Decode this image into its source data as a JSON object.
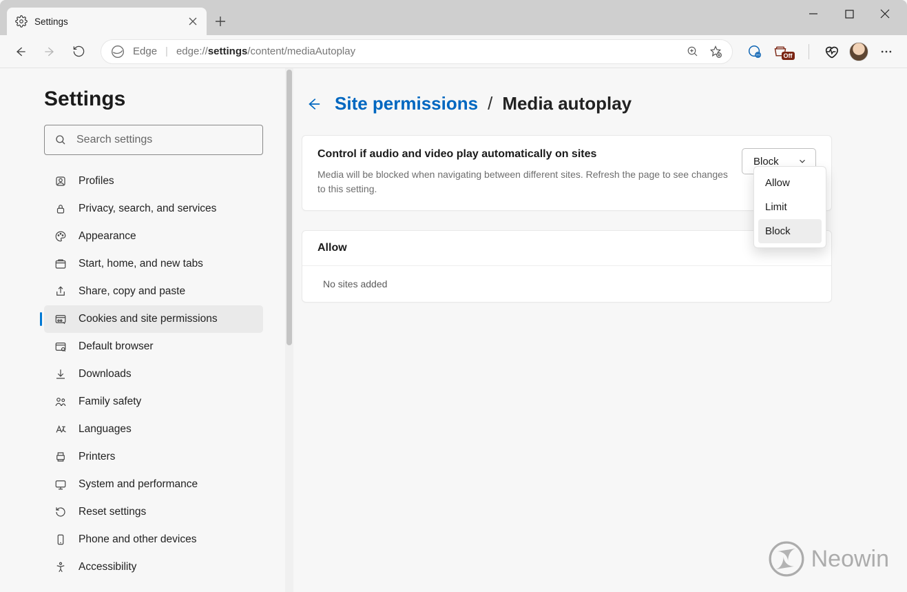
{
  "tab": {
    "title": "Settings"
  },
  "addressbar": {
    "identity": "Edge",
    "url_prefix": "edge://",
    "url_bold": "settings",
    "url_rest": "/content/mediaAutoplay"
  },
  "sidebar": {
    "title": "Settings",
    "search_placeholder": "Search settings",
    "items": [
      {
        "label": "Profiles",
        "icon": "profile-icon"
      },
      {
        "label": "Privacy, search, and services",
        "icon": "lock-icon"
      },
      {
        "label": "Appearance",
        "icon": "palette-icon"
      },
      {
        "label": "Start, home, and new tabs",
        "icon": "tabs-icon"
      },
      {
        "label": "Share, copy and paste",
        "icon": "share-icon"
      },
      {
        "label": "Cookies and site permissions",
        "icon": "cookies-icon",
        "active": true
      },
      {
        "label": "Default browser",
        "icon": "browser-icon"
      },
      {
        "label": "Downloads",
        "icon": "download-icon"
      },
      {
        "label": "Family safety",
        "icon": "family-icon"
      },
      {
        "label": "Languages",
        "icon": "language-icon"
      },
      {
        "label": "Printers",
        "icon": "printer-icon"
      },
      {
        "label": "System and performance",
        "icon": "system-icon"
      },
      {
        "label": "Reset settings",
        "icon": "reset-icon"
      },
      {
        "label": "Phone and other devices",
        "icon": "phone-icon"
      },
      {
        "label": "Accessibility",
        "icon": "accessibility-icon"
      }
    ]
  },
  "main": {
    "breadcrumb_link": "Site permissions",
    "breadcrumb_current": "Media autoplay",
    "setting_title": "Control if audio and video play automatically on sites",
    "setting_desc": "Media will be blocked when navigating between different sites. Refresh the page to see changes to this setting.",
    "dropdown_value": "Block",
    "dropdown_options": [
      "Allow",
      "Limit",
      "Block"
    ],
    "allow_header": "Allow",
    "allow_empty": "No sites added"
  },
  "watermark": "Neowin"
}
